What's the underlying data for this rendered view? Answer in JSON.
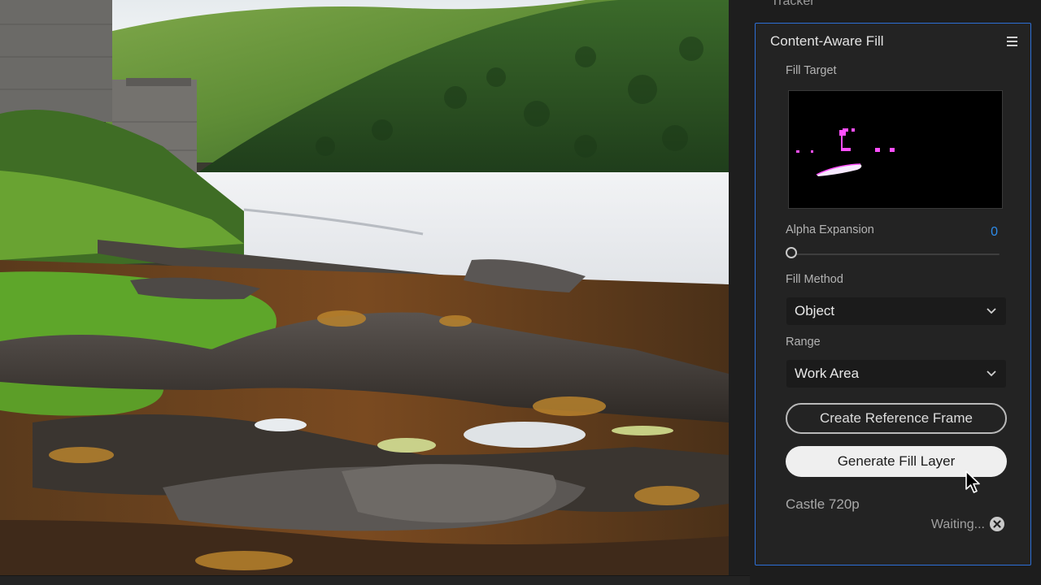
{
  "tabs": {
    "tracker": "Tracker"
  },
  "panel": {
    "title": "Content-Aware Fill",
    "fill_target": {
      "label": "Fill Target"
    },
    "alpha_expansion": {
      "label": "Alpha Expansion",
      "value": "0"
    },
    "fill_method": {
      "label": "Fill Method",
      "value": "Object"
    },
    "range": {
      "label": "Range",
      "value": "Work Area"
    },
    "buttons": {
      "create_reference": "Create Reference Frame",
      "generate_fill": "Generate Fill Layer"
    },
    "layer_name": "Castle 720p",
    "status": "Waiting..."
  },
  "colors": {
    "accent": "#2d8ceb",
    "panel_border": "#2d6fd6",
    "mask": "#ff4fff"
  },
  "icons": {
    "panel_menu": "hamburger-menu-icon",
    "dropdown": "chevron-down-icon",
    "cancel": "close-circle-icon",
    "pointer": "mouse-cursor-icon"
  }
}
